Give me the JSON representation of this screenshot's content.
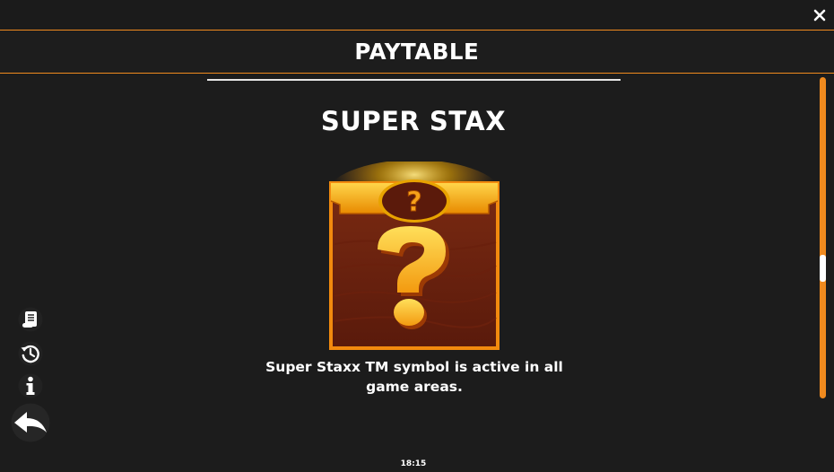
{
  "header": {
    "title": "PAYTABLE"
  },
  "section": {
    "title": "SUPER STAX",
    "description": "Super Staxx TM symbol is active in all game areas."
  },
  "symbol": {
    "icon": "question-mark-mystery-symbol",
    "top_badge_glyph": "?",
    "main_glyph": "?"
  },
  "side_menu": {
    "items": [
      {
        "icon": "paytable-scroll-icon"
      },
      {
        "icon": "history-icon"
      },
      {
        "icon": "info-icon"
      },
      {
        "icon": "back-arrow-icon"
      }
    ]
  },
  "status": {
    "clock": "18:15"
  },
  "colors": {
    "background": "#1c1c1c",
    "accent": "#f08a1e",
    "text": "#ffffff"
  }
}
